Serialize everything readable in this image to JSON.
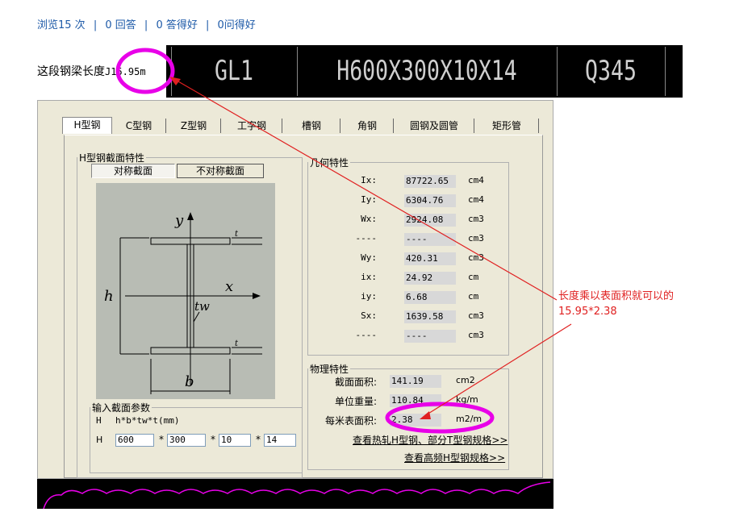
{
  "stats": {
    "views": "浏览15 次",
    "answers": "0 回答",
    "good_answers": "0 答得好",
    "good_questions": "0问得好",
    "sep": "|"
  },
  "length_label": {
    "text": "这段钢梁长度",
    "value": "J15.95m"
  },
  "cad": {
    "cells": [
      "GL1",
      "H600X300X10X14",
      "Q345"
    ]
  },
  "tabs": [
    "H型钢",
    "C型钢",
    "Z型钢",
    "工字钢",
    "槽钢",
    "角钢",
    "圆钢及圆管",
    "矩形管"
  ],
  "section_group": {
    "legend": "H型钢截面特性",
    "sym_button": "对称截面",
    "asym_button": "不对称截面"
  },
  "drawing": {
    "y": "y",
    "x": "x",
    "h": "h",
    "tw": "tw",
    "b": "b",
    "t": "t"
  },
  "geometry": {
    "legend": "几何特性",
    "rows": [
      {
        "label": "Ix:",
        "value": "87722.65",
        "unit": "cm4"
      },
      {
        "label": "Iy:",
        "value": "6304.76",
        "unit": "cm4"
      },
      {
        "label": "Wx:",
        "value": "2924.08",
        "unit": "cm3"
      },
      {
        "label": "----",
        "value": "----",
        "unit": "cm3"
      },
      {
        "label": "Wy:",
        "value": "420.31",
        "unit": "cm3"
      },
      {
        "label": "ix:",
        "value": "24.92",
        "unit": "cm"
      },
      {
        "label": "iy:",
        "value": "6.68",
        "unit": "cm"
      },
      {
        "label": "Sx:",
        "value": "1639.58",
        "unit": "cm3"
      },
      {
        "label": "----",
        "value": "----",
        "unit": "cm3"
      }
    ]
  },
  "physical": {
    "legend": "物理特性",
    "rows": [
      {
        "label": "截面面积:",
        "value": "141.19",
        "unit": "cm2"
      },
      {
        "label": "单位重量:",
        "value": "110.84",
        "unit": "kg/m"
      },
      {
        "label": "每米表面积:",
        "value": "2.38",
        "unit": "m2/m"
      }
    ],
    "link1": "查看热轧H型钢、部分T型钢规格>>",
    "link2": "查看高频H型钢规格>>"
  },
  "input_params": {
    "legend": "输入截面参数",
    "formula_prefix": "H",
    "formula": "h*b*tw*t(mm)",
    "row_prefix": "H",
    "mult": "*",
    "values": [
      "600",
      "300",
      "10",
      "14"
    ]
  },
  "annotation": {
    "line1": "长度乘以表面积就可以的",
    "line2": "15.95*2.38"
  },
  "colors": {
    "annotation": "#e02020",
    "highlight": "#e800e8",
    "link": "#1e5aa8"
  }
}
